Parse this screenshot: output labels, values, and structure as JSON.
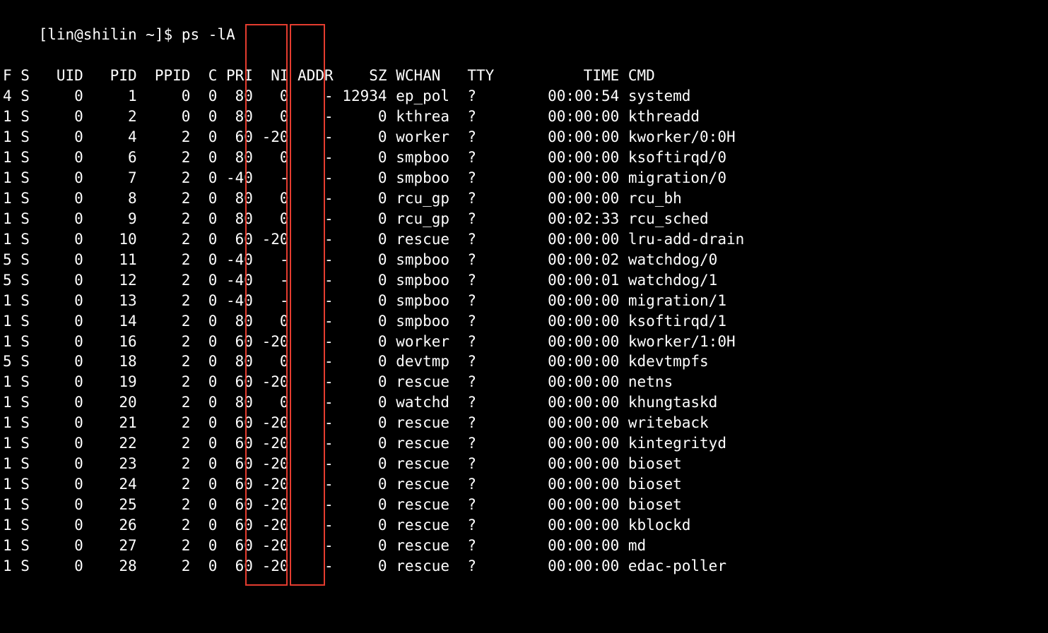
{
  "prompt": "[lin@shilin ~]$ ",
  "command": "ps -lA",
  "headers": {
    "F": "F",
    "S": "S",
    "UID": "UID",
    "PID": "PID",
    "PPID": "PPID",
    "C": "C",
    "PRI": "PRI",
    "NI": "NI",
    "ADDR": "ADDR",
    "SZ": "SZ",
    "WCHAN": "WCHAN",
    "TTY": "TTY",
    "TIME": "TIME",
    "CMD": "CMD"
  },
  "rows": [
    {
      "F": "4",
      "S": "S",
      "UID": "0",
      "PID": "1",
      "PPID": "0",
      "C": "0",
      "PRI": "80",
      "NI": "0",
      "ADDR": "-",
      "SZ": "12934",
      "WCHAN": "ep_pol",
      "TTY": "?",
      "TIME": "00:00:54",
      "CMD": "systemd"
    },
    {
      "F": "1",
      "S": "S",
      "UID": "0",
      "PID": "2",
      "PPID": "0",
      "C": "0",
      "PRI": "80",
      "NI": "0",
      "ADDR": "-",
      "SZ": "0",
      "WCHAN": "kthrea",
      "TTY": "?",
      "TIME": "00:00:00",
      "CMD": "kthreadd"
    },
    {
      "F": "1",
      "S": "S",
      "UID": "0",
      "PID": "4",
      "PPID": "2",
      "C": "0",
      "PRI": "60",
      "NI": "-20",
      "ADDR": "-",
      "SZ": "0",
      "WCHAN": "worker",
      "TTY": "?",
      "TIME": "00:00:00",
      "CMD": "kworker/0:0H"
    },
    {
      "F": "1",
      "S": "S",
      "UID": "0",
      "PID": "6",
      "PPID": "2",
      "C": "0",
      "PRI": "80",
      "NI": "0",
      "ADDR": "-",
      "SZ": "0",
      "WCHAN": "smpboo",
      "TTY": "?",
      "TIME": "00:00:00",
      "CMD": "ksoftirqd/0"
    },
    {
      "F": "1",
      "S": "S",
      "UID": "0",
      "PID": "7",
      "PPID": "2",
      "C": "0",
      "PRI": "-40",
      "NI": "-",
      "ADDR": "-",
      "SZ": "0",
      "WCHAN": "smpboo",
      "TTY": "?",
      "TIME": "00:00:00",
      "CMD": "migration/0"
    },
    {
      "F": "1",
      "S": "S",
      "UID": "0",
      "PID": "8",
      "PPID": "2",
      "C": "0",
      "PRI": "80",
      "NI": "0",
      "ADDR": "-",
      "SZ": "0",
      "WCHAN": "rcu_gp",
      "TTY": "?",
      "TIME": "00:00:00",
      "CMD": "rcu_bh"
    },
    {
      "F": "1",
      "S": "S",
      "UID": "0",
      "PID": "9",
      "PPID": "2",
      "C": "0",
      "PRI": "80",
      "NI": "0",
      "ADDR": "-",
      "SZ": "0",
      "WCHAN": "rcu_gp",
      "TTY": "?",
      "TIME": "00:02:33",
      "CMD": "rcu_sched"
    },
    {
      "F": "1",
      "S": "S",
      "UID": "0",
      "PID": "10",
      "PPID": "2",
      "C": "0",
      "PRI": "60",
      "NI": "-20",
      "ADDR": "-",
      "SZ": "0",
      "WCHAN": "rescue",
      "TTY": "?",
      "TIME": "00:00:00",
      "CMD": "lru-add-drain"
    },
    {
      "F": "5",
      "S": "S",
      "UID": "0",
      "PID": "11",
      "PPID": "2",
      "C": "0",
      "PRI": "-40",
      "NI": "-",
      "ADDR": "-",
      "SZ": "0",
      "WCHAN": "smpboo",
      "TTY": "?",
      "TIME": "00:00:02",
      "CMD": "watchdog/0"
    },
    {
      "F": "5",
      "S": "S",
      "UID": "0",
      "PID": "12",
      "PPID": "2",
      "C": "0",
      "PRI": "-40",
      "NI": "-",
      "ADDR": "-",
      "SZ": "0",
      "WCHAN": "smpboo",
      "TTY": "?",
      "TIME": "00:00:01",
      "CMD": "watchdog/1"
    },
    {
      "F": "1",
      "S": "S",
      "UID": "0",
      "PID": "13",
      "PPID": "2",
      "C": "0",
      "PRI": "-40",
      "NI": "-",
      "ADDR": "-",
      "SZ": "0",
      "WCHAN": "smpboo",
      "TTY": "?",
      "TIME": "00:00:00",
      "CMD": "migration/1"
    },
    {
      "F": "1",
      "S": "S",
      "UID": "0",
      "PID": "14",
      "PPID": "2",
      "C": "0",
      "PRI": "80",
      "NI": "0",
      "ADDR": "-",
      "SZ": "0",
      "WCHAN": "smpboo",
      "TTY": "?",
      "TIME": "00:00:00",
      "CMD": "ksoftirqd/1"
    },
    {
      "F": "1",
      "S": "S",
      "UID": "0",
      "PID": "16",
      "PPID": "2",
      "C": "0",
      "PRI": "60",
      "NI": "-20",
      "ADDR": "-",
      "SZ": "0",
      "WCHAN": "worker",
      "TTY": "?",
      "TIME": "00:00:00",
      "CMD": "kworker/1:0H"
    },
    {
      "F": "5",
      "S": "S",
      "UID": "0",
      "PID": "18",
      "PPID": "2",
      "C": "0",
      "PRI": "80",
      "NI": "0",
      "ADDR": "-",
      "SZ": "0",
      "WCHAN": "devtmp",
      "TTY": "?",
      "TIME": "00:00:00",
      "CMD": "kdevtmpfs"
    },
    {
      "F": "1",
      "S": "S",
      "UID": "0",
      "PID": "19",
      "PPID": "2",
      "C": "0",
      "PRI": "60",
      "NI": "-20",
      "ADDR": "-",
      "SZ": "0",
      "WCHAN": "rescue",
      "TTY": "?",
      "TIME": "00:00:00",
      "CMD": "netns"
    },
    {
      "F": "1",
      "S": "S",
      "UID": "0",
      "PID": "20",
      "PPID": "2",
      "C": "0",
      "PRI": "80",
      "NI": "0",
      "ADDR": "-",
      "SZ": "0",
      "WCHAN": "watchd",
      "TTY": "?",
      "TIME": "00:00:00",
      "CMD": "khungtaskd"
    },
    {
      "F": "1",
      "S": "S",
      "UID": "0",
      "PID": "21",
      "PPID": "2",
      "C": "0",
      "PRI": "60",
      "NI": "-20",
      "ADDR": "-",
      "SZ": "0",
      "WCHAN": "rescue",
      "TTY": "?",
      "TIME": "00:00:00",
      "CMD": "writeback"
    },
    {
      "F": "1",
      "S": "S",
      "UID": "0",
      "PID": "22",
      "PPID": "2",
      "C": "0",
      "PRI": "60",
      "NI": "-20",
      "ADDR": "-",
      "SZ": "0",
      "WCHAN": "rescue",
      "TTY": "?",
      "TIME": "00:00:00",
      "CMD": "kintegrityd"
    },
    {
      "F": "1",
      "S": "S",
      "UID": "0",
      "PID": "23",
      "PPID": "2",
      "C": "0",
      "PRI": "60",
      "NI": "-20",
      "ADDR": "-",
      "SZ": "0",
      "WCHAN": "rescue",
      "TTY": "?",
      "TIME": "00:00:00",
      "CMD": "bioset"
    },
    {
      "F": "1",
      "S": "S",
      "UID": "0",
      "PID": "24",
      "PPID": "2",
      "C": "0",
      "PRI": "60",
      "NI": "-20",
      "ADDR": "-",
      "SZ": "0",
      "WCHAN": "rescue",
      "TTY": "?",
      "TIME": "00:00:00",
      "CMD": "bioset"
    },
    {
      "F": "1",
      "S": "S",
      "UID": "0",
      "PID": "25",
      "PPID": "2",
      "C": "0",
      "PRI": "60",
      "NI": "-20",
      "ADDR": "-",
      "SZ": "0",
      "WCHAN": "rescue",
      "TTY": "?",
      "TIME": "00:00:00",
      "CMD": "bioset"
    },
    {
      "F": "1",
      "S": "S",
      "UID": "0",
      "PID": "26",
      "PPID": "2",
      "C": "0",
      "PRI": "60",
      "NI": "-20",
      "ADDR": "-",
      "SZ": "0",
      "WCHAN": "rescue",
      "TTY": "?",
      "TIME": "00:00:00",
      "CMD": "kblockd"
    },
    {
      "F": "1",
      "S": "S",
      "UID": "0",
      "PID": "27",
      "PPID": "2",
      "C": "0",
      "PRI": "60",
      "NI": "-20",
      "ADDR": "-",
      "SZ": "0",
      "WCHAN": "rescue",
      "TTY": "?",
      "TIME": "00:00:00",
      "CMD": "md"
    },
    {
      "F": "1",
      "S": "S",
      "UID": "0",
      "PID": "28",
      "PPID": "2",
      "C": "0",
      "PRI": "60",
      "NI": "-20",
      "ADDR": "-",
      "SZ": "0",
      "WCHAN": "rescue",
      "TTY": "?",
      "TIME": "00:00:00",
      "CMD": "edac-poller"
    }
  ],
  "highlight": {
    "columns": [
      "PRI",
      "NI"
    ],
    "color": "#e43c2f"
  }
}
